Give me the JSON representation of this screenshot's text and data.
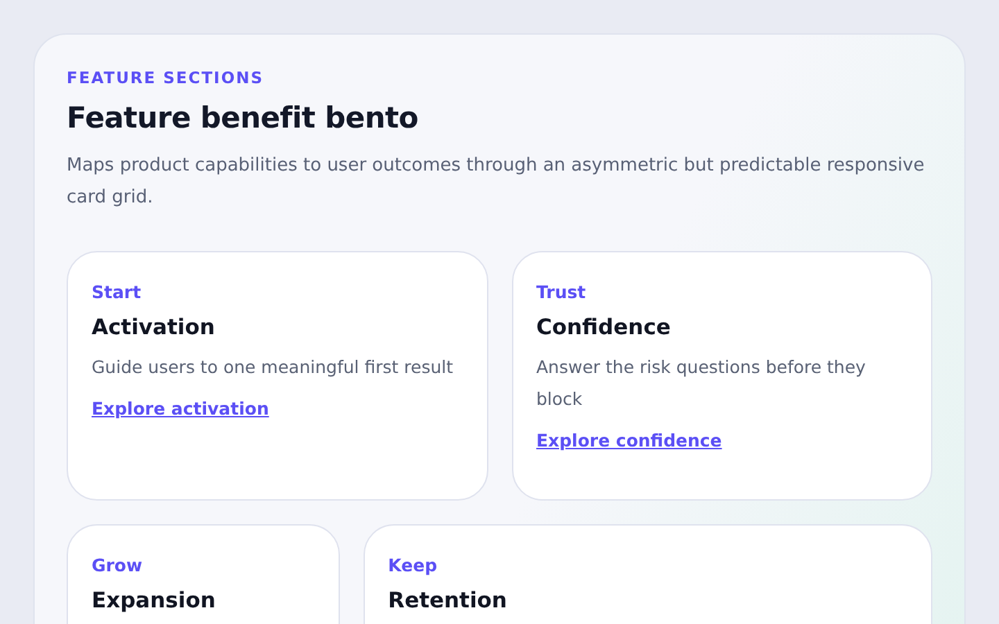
{
  "section": {
    "eyebrow": "FEATURE SECTIONS",
    "title": "Feature benefit bento",
    "description": "Maps product capabilities to user outcomes through an asymmetric but predictable responsive card grid."
  },
  "cards": [
    {
      "eyebrow": "Start",
      "title": "Activation",
      "description": "Guide users to one meaningful first result",
      "link": "Explore activation"
    },
    {
      "eyebrow": "Trust",
      "title": "Confidence",
      "description": "Answer the risk questions before they block",
      "link": "Explore confidence"
    },
    {
      "eyebrow": "Grow",
      "title": "Expansion"
    },
    {
      "eyebrow": "Keep",
      "title": "Retention"
    }
  ]
}
